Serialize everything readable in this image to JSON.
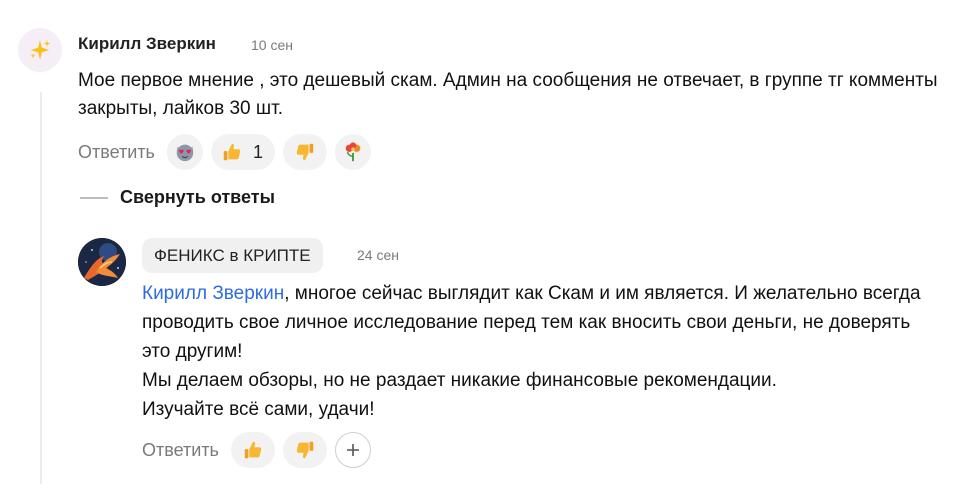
{
  "comments": [
    {
      "author": "Кирилл Зверкин",
      "date": "10 сен",
      "avatar_icon": "sparkles-icon",
      "text": "Мое первое мнение , это дешевый скам. Админ на сообщения не отвечает, в группе тг комменты закрыты, лайков 30 шт.",
      "reply_label": "Ответить",
      "reactions": [
        {
          "icon": "heart-eyes-cat-icon",
          "count": ""
        },
        {
          "icon": "thumbs-up-icon",
          "count": "1"
        },
        {
          "icon": "thumbs-down-icon",
          "count": ""
        },
        {
          "icon": "flowers-icon",
          "count": ""
        }
      ]
    }
  ],
  "collapse_label": "Свернуть ответы",
  "reply": {
    "author": "ФЕНИКС в КРИПТЕ",
    "date": "24 сен",
    "avatar_icon": "phoenix-avatar",
    "mention": "Кирилл Зверкин",
    "text_after_mention": ", многое сейчас выглядит как Скам и им является. И желательно всегда проводить свое личное исследование перед тем как вносить свои деньги, не доверять это другим!",
    "text_line2": "Мы делаем обзоры, но не раздает никакие финансовые рекомендации.",
    "text_line3": "Изучайте всё сами, удачи!",
    "reply_label": "Ответить",
    "add_reaction_icon": "plus-icon"
  },
  "colors": {
    "mention": "#2d6cdf",
    "thumb": "#f5a623",
    "reaction_bg": "#f2f2f2"
  }
}
